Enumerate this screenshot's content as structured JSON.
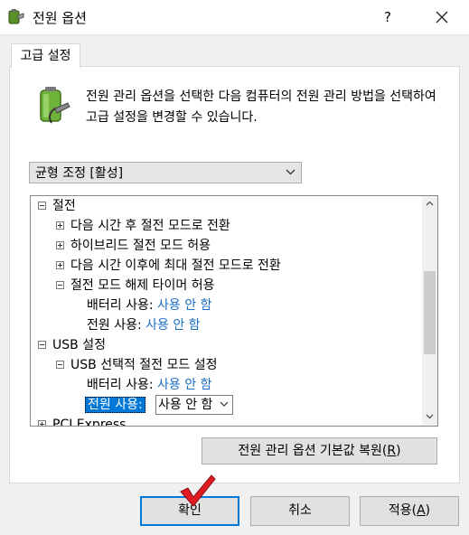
{
  "window": {
    "title": "전원 옵션",
    "help": "?"
  },
  "tab": {
    "label": "고급 설정"
  },
  "description": "전원 관리 옵션을 선택한 다음 컴퓨터의 전원 관리 방법을 선택하여 고급 설정을 변경할 수 있습니다.",
  "plan_select": {
    "value": "균형 조정 [활성]"
  },
  "tree": {
    "items": [
      {
        "label": "절전",
        "expander": "minus"
      },
      {
        "label": "다음 시간 후 절전 모드로 전환",
        "expander": "plus"
      },
      {
        "label": "하이브리드 절전 모드 허용",
        "expander": "plus"
      },
      {
        "label": "다음 시간 이후에 최대 절전 모드로 전환",
        "expander": "plus"
      },
      {
        "label": "절전 모드 해제 타이머 허용",
        "expander": "minus"
      },
      {
        "label": "배터리 사용:",
        "value": "사용 안 함"
      },
      {
        "label": "전원 사용:",
        "value": "사용 안 함"
      },
      {
        "label": "USB 설정",
        "expander": "minus"
      },
      {
        "label": "USB 선택적 절전 모드 설정",
        "expander": "minus"
      },
      {
        "label": "배터리 사용:",
        "value": "사용 안 함"
      },
      {
        "label": "전원 사용:",
        "value": "사용 안 함"
      },
      {
        "label": "PCI Express",
        "expander": "plus"
      }
    ]
  },
  "restore_button": {
    "label": "전원 관리 옵션 기본값 복원(",
    "accel": "R",
    "tail": ")"
  },
  "buttons": {
    "ok": "확인",
    "cancel": "취소",
    "apply_label": "적용(",
    "apply_accel": "A",
    "apply_tail": ")"
  },
  "colors": {
    "link": "#1b6fc7",
    "selection": "#0078d7",
    "focus": "#0078d7",
    "checkmark": "#e01b22"
  }
}
